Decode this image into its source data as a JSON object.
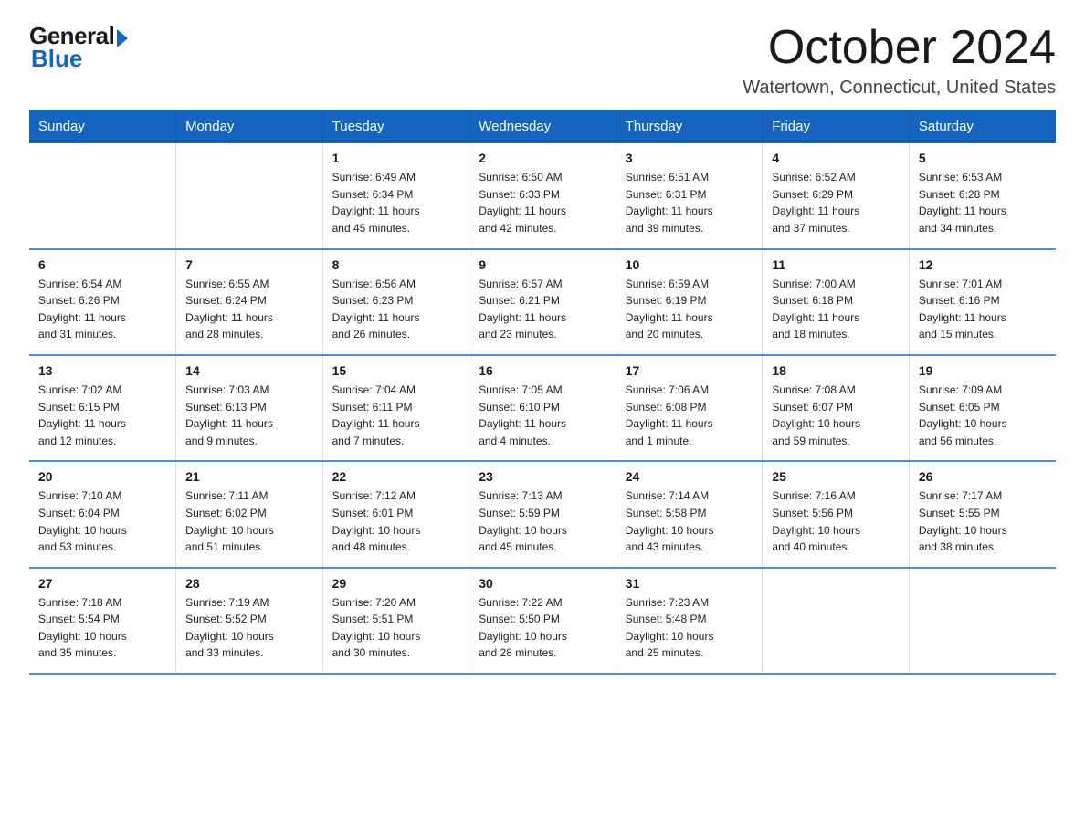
{
  "logo": {
    "general": "General",
    "blue": "Blue"
  },
  "title": "October 2024",
  "location": "Watertown, Connecticut, United States",
  "headers": [
    "Sunday",
    "Monday",
    "Tuesday",
    "Wednesday",
    "Thursday",
    "Friday",
    "Saturday"
  ],
  "weeks": [
    [
      {
        "day": "",
        "info": ""
      },
      {
        "day": "",
        "info": ""
      },
      {
        "day": "1",
        "info": "Sunrise: 6:49 AM\nSunset: 6:34 PM\nDaylight: 11 hours\nand 45 minutes."
      },
      {
        "day": "2",
        "info": "Sunrise: 6:50 AM\nSunset: 6:33 PM\nDaylight: 11 hours\nand 42 minutes."
      },
      {
        "day": "3",
        "info": "Sunrise: 6:51 AM\nSunset: 6:31 PM\nDaylight: 11 hours\nand 39 minutes."
      },
      {
        "day": "4",
        "info": "Sunrise: 6:52 AM\nSunset: 6:29 PM\nDaylight: 11 hours\nand 37 minutes."
      },
      {
        "day": "5",
        "info": "Sunrise: 6:53 AM\nSunset: 6:28 PM\nDaylight: 11 hours\nand 34 minutes."
      }
    ],
    [
      {
        "day": "6",
        "info": "Sunrise: 6:54 AM\nSunset: 6:26 PM\nDaylight: 11 hours\nand 31 minutes."
      },
      {
        "day": "7",
        "info": "Sunrise: 6:55 AM\nSunset: 6:24 PM\nDaylight: 11 hours\nand 28 minutes."
      },
      {
        "day": "8",
        "info": "Sunrise: 6:56 AM\nSunset: 6:23 PM\nDaylight: 11 hours\nand 26 minutes."
      },
      {
        "day": "9",
        "info": "Sunrise: 6:57 AM\nSunset: 6:21 PM\nDaylight: 11 hours\nand 23 minutes."
      },
      {
        "day": "10",
        "info": "Sunrise: 6:59 AM\nSunset: 6:19 PM\nDaylight: 11 hours\nand 20 minutes."
      },
      {
        "day": "11",
        "info": "Sunrise: 7:00 AM\nSunset: 6:18 PM\nDaylight: 11 hours\nand 18 minutes."
      },
      {
        "day": "12",
        "info": "Sunrise: 7:01 AM\nSunset: 6:16 PM\nDaylight: 11 hours\nand 15 minutes."
      }
    ],
    [
      {
        "day": "13",
        "info": "Sunrise: 7:02 AM\nSunset: 6:15 PM\nDaylight: 11 hours\nand 12 minutes."
      },
      {
        "day": "14",
        "info": "Sunrise: 7:03 AM\nSunset: 6:13 PM\nDaylight: 11 hours\nand 9 minutes."
      },
      {
        "day": "15",
        "info": "Sunrise: 7:04 AM\nSunset: 6:11 PM\nDaylight: 11 hours\nand 7 minutes."
      },
      {
        "day": "16",
        "info": "Sunrise: 7:05 AM\nSunset: 6:10 PM\nDaylight: 11 hours\nand 4 minutes."
      },
      {
        "day": "17",
        "info": "Sunrise: 7:06 AM\nSunset: 6:08 PM\nDaylight: 11 hours\nand 1 minute."
      },
      {
        "day": "18",
        "info": "Sunrise: 7:08 AM\nSunset: 6:07 PM\nDaylight: 10 hours\nand 59 minutes."
      },
      {
        "day": "19",
        "info": "Sunrise: 7:09 AM\nSunset: 6:05 PM\nDaylight: 10 hours\nand 56 minutes."
      }
    ],
    [
      {
        "day": "20",
        "info": "Sunrise: 7:10 AM\nSunset: 6:04 PM\nDaylight: 10 hours\nand 53 minutes."
      },
      {
        "day": "21",
        "info": "Sunrise: 7:11 AM\nSunset: 6:02 PM\nDaylight: 10 hours\nand 51 minutes."
      },
      {
        "day": "22",
        "info": "Sunrise: 7:12 AM\nSunset: 6:01 PM\nDaylight: 10 hours\nand 48 minutes."
      },
      {
        "day": "23",
        "info": "Sunrise: 7:13 AM\nSunset: 5:59 PM\nDaylight: 10 hours\nand 45 minutes."
      },
      {
        "day": "24",
        "info": "Sunrise: 7:14 AM\nSunset: 5:58 PM\nDaylight: 10 hours\nand 43 minutes."
      },
      {
        "day": "25",
        "info": "Sunrise: 7:16 AM\nSunset: 5:56 PM\nDaylight: 10 hours\nand 40 minutes."
      },
      {
        "day": "26",
        "info": "Sunrise: 7:17 AM\nSunset: 5:55 PM\nDaylight: 10 hours\nand 38 minutes."
      }
    ],
    [
      {
        "day": "27",
        "info": "Sunrise: 7:18 AM\nSunset: 5:54 PM\nDaylight: 10 hours\nand 35 minutes."
      },
      {
        "day": "28",
        "info": "Sunrise: 7:19 AM\nSunset: 5:52 PM\nDaylight: 10 hours\nand 33 minutes."
      },
      {
        "day": "29",
        "info": "Sunrise: 7:20 AM\nSunset: 5:51 PM\nDaylight: 10 hours\nand 30 minutes."
      },
      {
        "day": "30",
        "info": "Sunrise: 7:22 AM\nSunset: 5:50 PM\nDaylight: 10 hours\nand 28 minutes."
      },
      {
        "day": "31",
        "info": "Sunrise: 7:23 AM\nSunset: 5:48 PM\nDaylight: 10 hours\nand 25 minutes."
      },
      {
        "day": "",
        "info": ""
      },
      {
        "day": "",
        "info": ""
      }
    ]
  ]
}
